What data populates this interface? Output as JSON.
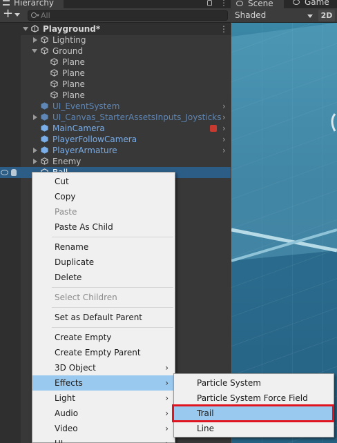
{
  "hierarchy": {
    "tab_title": "Hierarchy",
    "tab_menu": "⋮",
    "search_placeholder": "All",
    "scene_name": "Playground*",
    "scene_menu": "⋮",
    "items": [
      {
        "label": "Lighting"
      },
      {
        "label": "Ground"
      },
      {
        "label": "Plane"
      },
      {
        "label": "Plane"
      },
      {
        "label": "Plane"
      },
      {
        "label": "Plane"
      },
      {
        "label": "UI_EventSystem"
      },
      {
        "label": "UI_Canvas_StarterAssetsInputs_Joysticks"
      },
      {
        "label": "MainCamera"
      },
      {
        "label": "PlayerFollowCamera"
      },
      {
        "label": "PlayerArmature"
      },
      {
        "label": "Enemy"
      },
      {
        "label": "Ball"
      }
    ],
    "row_chevron": "›"
  },
  "scene_view": {
    "tabs": [
      {
        "label": "Scene"
      },
      {
        "label": "Game"
      }
    ],
    "shading_mode": "Shaded",
    "mode_2d_label": "2D"
  },
  "context_menu": {
    "items": [
      {
        "label": "Cut"
      },
      {
        "label": "Copy"
      },
      {
        "label": "Paste"
      },
      {
        "label": "Paste As Child"
      },
      {
        "label": "Rename"
      },
      {
        "label": "Duplicate"
      },
      {
        "label": "Delete"
      },
      {
        "label": "Select Children"
      },
      {
        "label": "Set as Default Parent"
      },
      {
        "label": "Create Empty"
      },
      {
        "label": "Create Empty Parent"
      },
      {
        "label": "3D Object"
      },
      {
        "label": "Effects"
      },
      {
        "label": "Light"
      },
      {
        "label": "Audio"
      },
      {
        "label": "Video"
      },
      {
        "label": "UI"
      }
    ],
    "submenu_arrow": "›"
  },
  "effects_submenu": {
    "items": [
      {
        "label": "Particle System"
      },
      {
        "label": "Particle System Force Field"
      },
      {
        "label": "Trail"
      },
      {
        "label": "Line"
      }
    ]
  },
  "colors": {
    "highlight": "#99c9ef",
    "selection_row": "#2c5d87",
    "annotation_box": "#e0141e",
    "prefab_text": "#7baee8"
  }
}
